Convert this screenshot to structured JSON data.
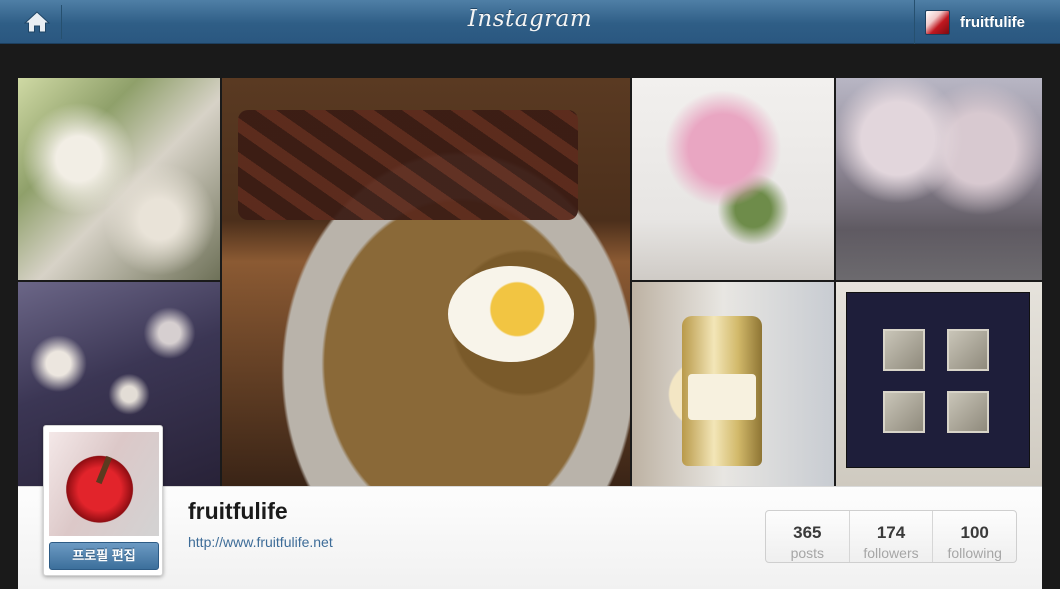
{
  "header": {
    "brand": "Instagram",
    "username": "fruitfulife",
    "home_icon": "home-icon"
  },
  "grid": {
    "photos": [
      "photo-1",
      "photo-2",
      "photo-3",
      "photo-4",
      "photo-5",
      "photo-6",
      "photo-7"
    ]
  },
  "profile": {
    "name": "fruitfulife",
    "url": "http://www.fruitfulife.net",
    "edit_button": "프로필 편집"
  },
  "stats": [
    {
      "value": "365",
      "label": "posts"
    },
    {
      "value": "174",
      "label": "followers"
    },
    {
      "value": "100",
      "label": "following"
    }
  ],
  "colors": {
    "header_blue": "#2f5e86",
    "link_blue": "#3d6c98"
  }
}
